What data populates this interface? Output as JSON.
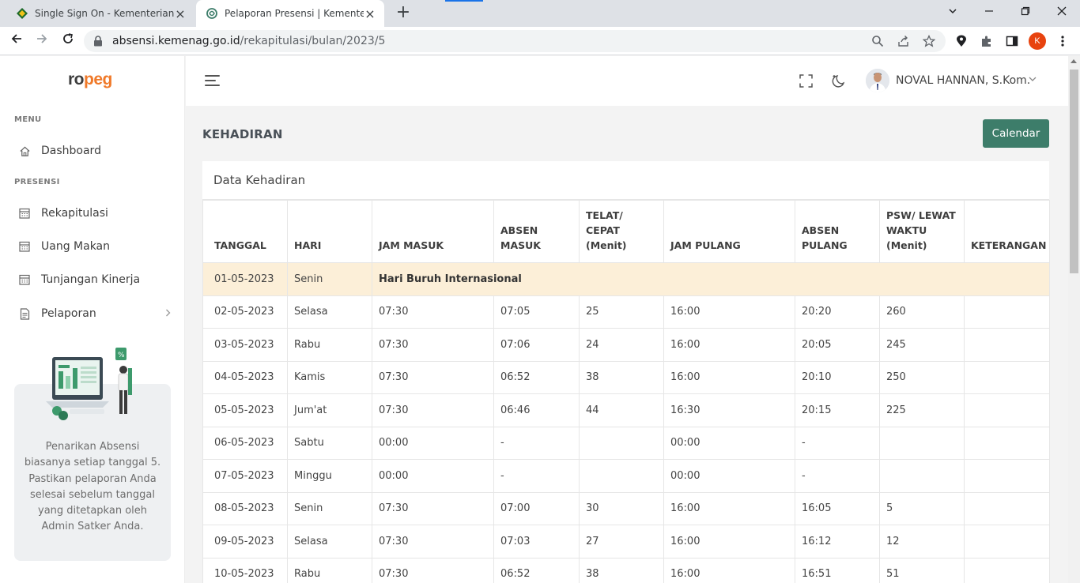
{
  "browser": {
    "tabs": [
      {
        "title": "Single Sign On - Kementerian Agama"
      },
      {
        "title": "Pelaporan Presensi | Kementerian Agama"
      }
    ],
    "url_host": "absensi.kemenag.go.id",
    "url_path": "/rekapitulasi/bulan/2023/5",
    "profile_initial": "K",
    "new_tab": "+"
  },
  "app": {
    "logo_ro": "ro",
    "logo_peg": "peg",
    "brand_color": "#f07a2a",
    "accent_color": "#3d7d6a"
  },
  "sidebar": {
    "menu_heading": "MENU",
    "dashboard_label": "Dashboard",
    "presensi_heading": "PRESENSI",
    "items": [
      {
        "label": "Rekapitulasi",
        "icon": "calendar-icon"
      },
      {
        "label": "Uang Makan",
        "icon": "calendar-icon"
      },
      {
        "label": "Tunjangan Kinerja",
        "icon": "calendar-icon"
      },
      {
        "label": "Pelaporan",
        "icon": "document-icon"
      }
    ],
    "promo_text": "Penarikan Absensi biasanya setiap tanggal 5. Pastikan pelaporan Anda selesai sebelum tanggal yang ditetapkan oleh Admin Satker Anda."
  },
  "header": {
    "user_name": "NOVAL HANNAN, S.Kom."
  },
  "main": {
    "page_title": "KEHADIRAN",
    "calendar_button": "Calendar",
    "card_title": "Data Kehadiran",
    "columns": [
      "TANGGAL",
      "HARI",
      "JAM MASUK",
      "ABSEN MASUK",
      "TELAT/ CEPAT (Menit)",
      "JAM PULANG",
      "ABSEN PULANG",
      "PSW/ LEWAT WAKTU (Menit)",
      "KETERANGAN"
    ],
    "holiday_row": {
      "tanggal": "01-05-2023",
      "hari": "Senin",
      "note": "Hari Buruh Internasional"
    },
    "rows": [
      [
        "02-05-2023",
        "Selasa",
        "07:30",
        "07:05",
        "25",
        "16:00",
        "20:20",
        "260",
        ""
      ],
      [
        "03-05-2023",
        "Rabu",
        "07:30",
        "07:06",
        "24",
        "16:00",
        "20:05",
        "245",
        ""
      ],
      [
        "04-05-2023",
        "Kamis",
        "07:30",
        "06:52",
        "38",
        "16:00",
        "20:10",
        "250",
        ""
      ],
      [
        "05-05-2023",
        "Jum'at",
        "07:30",
        "06:46",
        "44",
        "16:30",
        "20:15",
        "225",
        ""
      ],
      [
        "06-05-2023",
        "Sabtu",
        "00:00",
        "-",
        "",
        "00:00",
        "-",
        "",
        ""
      ],
      [
        "07-05-2023",
        "Minggu",
        "00:00",
        "-",
        "",
        "00:00",
        "-",
        "",
        ""
      ],
      [
        "08-05-2023",
        "Senin",
        "07:30",
        "07:00",
        "30",
        "16:00",
        "16:05",
        "5",
        ""
      ],
      [
        "09-05-2023",
        "Selasa",
        "07:30",
        "07:03",
        "27",
        "16:00",
        "16:12",
        "12",
        ""
      ],
      [
        "10-05-2023",
        "Rabu",
        "07:30",
        "06:52",
        "38",
        "16:00",
        "16:51",
        "51",
        ""
      ]
    ]
  }
}
